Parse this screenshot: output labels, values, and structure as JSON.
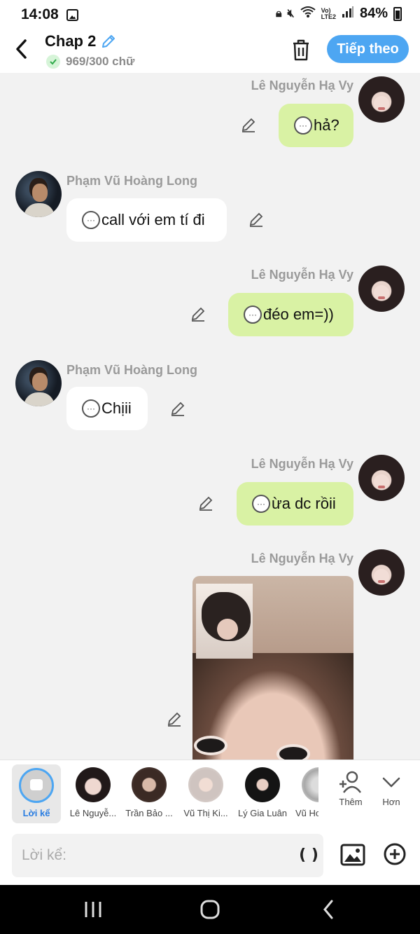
{
  "status_bar": {
    "time": "14:08",
    "battery": "84%",
    "network_label": "LTE2"
  },
  "header": {
    "title": "Chap 2",
    "char_count": "969/300 chữ",
    "next_button": "Tiếp theo"
  },
  "messages": [
    {
      "sender": "Lê Nguyễn Hạ Vy",
      "text": "hả?",
      "side": "right"
    },
    {
      "sender": "Phạm Vũ Hoàng Long",
      "text": "call với em tí đi",
      "side": "left"
    },
    {
      "sender": "Lê Nguyễn Hạ Vy",
      "text": "đéo em=))",
      "side": "right"
    },
    {
      "sender": "Phạm Vũ Hoàng Long",
      "text": "Chịii",
      "side": "left"
    },
    {
      "sender": "Lê Nguyễn Hạ Vy",
      "text": "ừa dc rồii",
      "side": "right"
    },
    {
      "sender": "Lê Nguyễn Hạ Vy",
      "text": "",
      "side": "right",
      "type": "image"
    }
  ],
  "characters": [
    {
      "label": "Lời kể"
    },
    {
      "label": "Lê Nguyễ..."
    },
    {
      "label": "Trần Bảo ..."
    },
    {
      "label": "Vũ Thị Ki..."
    },
    {
      "label": "Lý Gia Luân"
    },
    {
      "label": "Vũ Ho"
    }
  ],
  "actions": {
    "add_label": "Thêm",
    "more_label": "Hơn"
  },
  "composer": {
    "placeholder": "Lời kể:",
    "paren_label": "( )"
  },
  "colors": {
    "accent": "#4da6f2",
    "sent_bubble": "#d9f2a4",
    "received_bubble": "#ffffff",
    "background": "#f2f2f2"
  }
}
